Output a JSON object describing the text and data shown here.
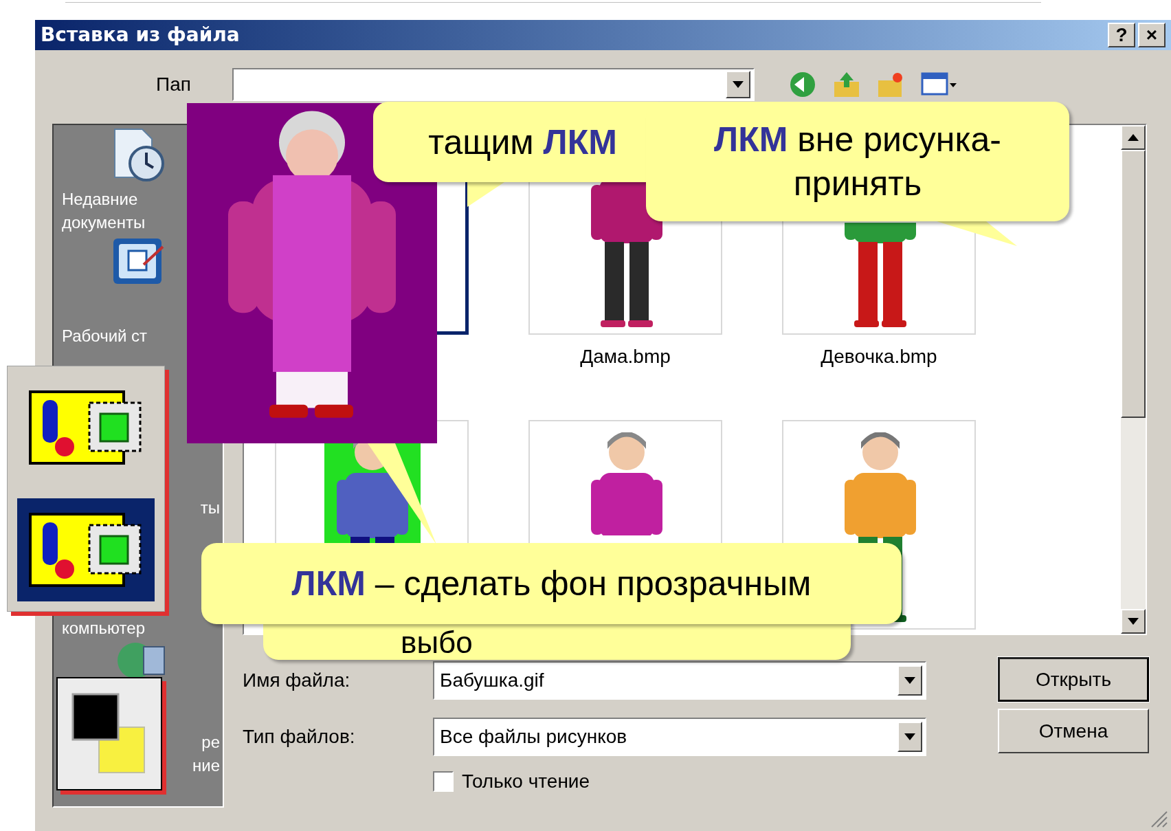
{
  "window": {
    "title": "Вставка из файла",
    "buttons": [
      "?",
      "×"
    ]
  },
  "folder": {
    "label": "Пап"
  },
  "sidebar": {
    "items": [
      {
        "lines": [
          "Недавние",
          "документы"
        ]
      },
      {
        "lines": [
          "Рабочий ст"
        ]
      },
      {
        "lines": [
          "ты"
        ]
      },
      {
        "lines": [
          "компьютер"
        ]
      },
      {
        "lines": [
          "ре",
          "ние"
        ]
      }
    ]
  },
  "files": [
    {
      "selected": true
    },
    {
      "name": "Дама.bmp",
      "selected": false
    },
    {
      "name": "Девочка.bmp",
      "selected": false
    },
    {
      "selected": false
    },
    {
      "selected": false
    },
    {
      "selected": false
    }
  ],
  "file_name": {
    "label": "Имя файла:",
    "value": "Бабушка.gif"
  },
  "file_type": {
    "label": "Тип файлов:",
    "value": "Все файлы рисунков"
  },
  "read_only": {
    "label": "Только чтение",
    "checked": false
  },
  "buttons": [
    {
      "label": "Открыть",
      "default": true
    },
    {
      "label": "Отмена",
      "default": false
    }
  ],
  "transparency_menu": {
    "options": [
      {
        "selected": false
      },
      {
        "selected": true
      }
    ]
  },
  "callouts": [
    {
      "text": "тащим **ЛКМ**"
    },
    {
      "text": "**ЛКМ** вне рисунка-принять"
    },
    {
      "text": "выбо"
    },
    {
      "text": "**ЛКМ** – сделать фон прозрачным"
    }
  ]
}
